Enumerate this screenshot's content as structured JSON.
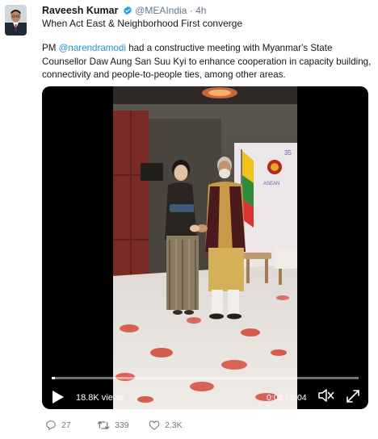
{
  "author": {
    "name": "Raveesh Kumar",
    "handle": "@MEAIndia",
    "separator": "·",
    "time": "4h"
  },
  "tweet": {
    "headline": "When Act East & Neighborhood First converge",
    "text_pre": "PM ",
    "mention": "@narendramodi",
    "text_post": " had a constructive meeting with Myanmar's State Counsellor Daw Aung San Suu Kyi to enhance cooperation in capacity building, connectivity and people-to-people ties, among other areas."
  },
  "video": {
    "views": "18.8K views",
    "timecode": "0:01 / 0:04",
    "progress": 0.01,
    "backdrop_text": "35",
    "backdrop_label": "ASEAN"
  },
  "actions": {
    "replies": "27",
    "retweets": "339",
    "likes": "2.3K"
  },
  "colors": {
    "link": "#1b95e0",
    "verified": "#1da1f2",
    "muted": "#657786"
  },
  "icons": {
    "verified": "verified-badge-icon",
    "reply": "reply-icon",
    "retweet": "retweet-icon",
    "like": "heart-icon",
    "play": "play-icon",
    "volume": "volume-icon",
    "fullscreen": "fullscreen-icon"
  }
}
